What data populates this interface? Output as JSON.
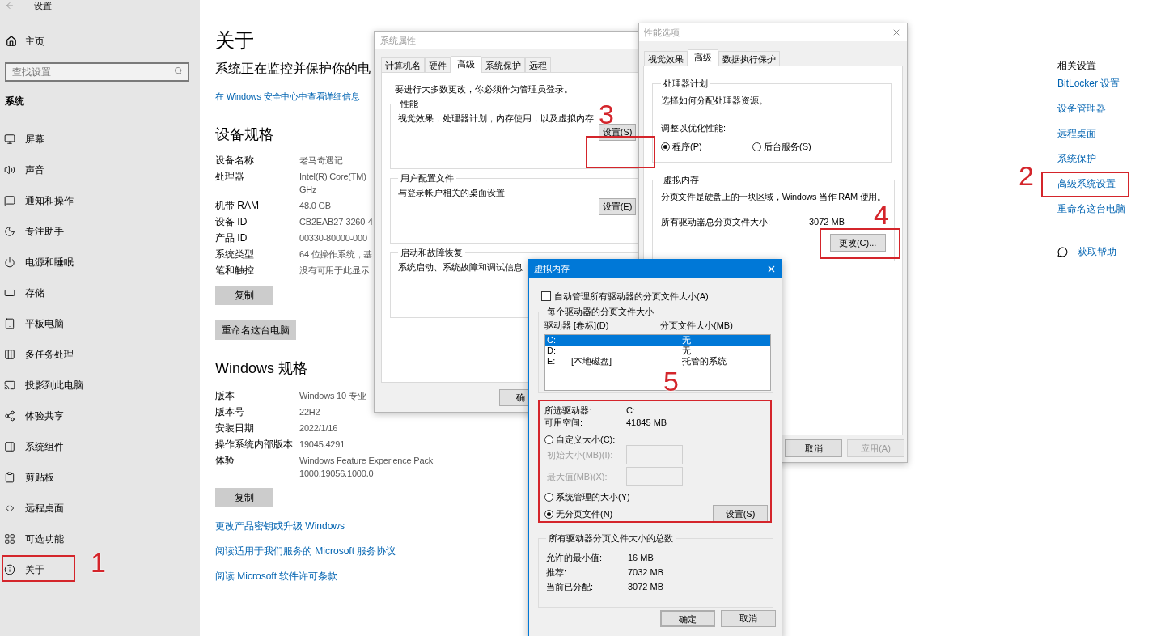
{
  "settings": {
    "title": "设置",
    "home": "主页",
    "search": {
      "placeholder": "查找设置"
    },
    "section": "系统",
    "nav": [
      {
        "label": "屏幕"
      },
      {
        "label": "声音"
      },
      {
        "label": "通知和操作"
      },
      {
        "label": "专注助手"
      },
      {
        "label": "电源和睡眠"
      },
      {
        "label": "存储"
      },
      {
        "label": "平板电脑"
      },
      {
        "label": "多任务处理"
      },
      {
        "label": "投影到此电脑"
      },
      {
        "label": "体验共享"
      },
      {
        "label": "系统组件"
      },
      {
        "label": "剪贴板"
      },
      {
        "label": "远程桌面"
      },
      {
        "label": "可选功能"
      },
      {
        "label": "关于"
      }
    ]
  },
  "about": {
    "title": "关于",
    "status": "系统正在监控并保护你的电",
    "security_link": "在 Windows 安全中心中查看详细信息",
    "device_heading": "设备规格",
    "device_specs": [
      {
        "label": "设备名称",
        "value": "老马奇遇记"
      },
      {
        "label": "处理器",
        "value": "Intel(R) Core(TM)\nGHz"
      },
      {
        "label": "机带 RAM",
        "value": "48.0 GB"
      },
      {
        "label": "设备 ID",
        "value": "CB2EAB27-3260-4"
      },
      {
        "label": "产品 ID",
        "value": "00330-80000-000"
      },
      {
        "label": "系统类型",
        "value": "64 位操作系统，基"
      },
      {
        "label": "笔和触控",
        "value": "没有可用于此显示"
      }
    ],
    "copy_button": "复制",
    "rename_button": "重命名这台电脑",
    "windows_heading": "Windows 规格",
    "windows_specs": [
      {
        "label": "版本",
        "value": "Windows 10 专业"
      },
      {
        "label": "版本号",
        "value": "22H2"
      },
      {
        "label": "安装日期",
        "value": "2022/1/16"
      },
      {
        "label": "操作系统内部版本",
        "value": "19045.4291"
      },
      {
        "label": "体验",
        "value": "Windows Feature Experience Pack\n1000.19056.1000.0"
      }
    ],
    "copy_button_2": "复制",
    "links": [
      "更改产品密钥或升级 Windows",
      "阅读适用于我们服务的 Microsoft 服务协议",
      "阅读 Microsoft 软件许可条款"
    ]
  },
  "related": {
    "heading": "相关设置",
    "links": [
      "BitLocker 设置",
      "设备管理器",
      "远程桌面",
      "系统保护",
      "高级系统设置",
      "重命名这台电脑"
    ],
    "help": "获取帮助"
  },
  "system_properties": {
    "title": "系统属性",
    "tabs": [
      {
        "label": "计算机名",
        "selected": false
      },
      {
        "label": "硬件",
        "selected": false
      },
      {
        "label": "高级",
        "selected": true
      },
      {
        "label": "系统保护",
        "selected": false
      },
      {
        "label": "远程",
        "selected": false
      }
    ],
    "note": "要进行大多数更改，你必须作为管理员登录。",
    "groups": [
      {
        "title": "性能",
        "text": "视觉效果，处理器计划，内存使用，以及虚拟内存",
        "button": "设置(S)"
      },
      {
        "title": "用户配置文件",
        "text": "与登录帐户相关的桌面设置",
        "button": "设置(E)"
      },
      {
        "title": "启动和故障恢复",
        "text": "系统启动、系统故障和调试信息"
      }
    ],
    "ok_button": "确"
  },
  "performance_options": {
    "title": "性能选项",
    "tabs": [
      {
        "label": "视觉效果",
        "selected": false
      },
      {
        "label": "高级",
        "selected": true
      },
      {
        "label": "数据执行保护",
        "selected": false
      }
    ],
    "processor_group": {
      "title": "处理器计划",
      "text": "选择如何分配处理器资源。",
      "prompt": "调整以优化性能:",
      "options": [
        {
          "label": "程序(P)",
          "selected": true
        },
        {
          "label": "后台服务(S)",
          "selected": false
        }
      ]
    },
    "vm_group": {
      "title": "虚拟内存",
      "text": "分页文件是硬盘上的一块区域，Windows 当作 RAM 使用。",
      "total_label": "所有驱动器总分页文件大小:",
      "total_value": "3072 MB",
      "change_button": "更改(C)..."
    },
    "buttons": [
      {
        "label": "取消",
        "disabled": false
      },
      {
        "label": "应用(A)",
        "disabled": true
      }
    ]
  },
  "virtual_memory": {
    "title": "虚拟内存",
    "auto_manage": {
      "label": "自动管理所有驱动器的分页文件大小(A)",
      "checked": false
    },
    "per_drive_title": "每个驱动器的分页文件大小",
    "columns": [
      "驱动器 [卷标](D)",
      "分页文件大小(MB)"
    ],
    "drives": [
      {
        "drive": "C:",
        "size": "无",
        "selected": true
      },
      {
        "drive": "D:",
        "size": "无",
        "selected": false
      },
      {
        "drive": "E:",
        "label": "[本地磁盘]",
        "size": "托管的系统",
        "selected": false
      }
    ],
    "selected_drive_label": "所选驱动器:",
    "selected_drive": "C:",
    "free_label": "可用空间:",
    "free_value": "41845 MB",
    "size_options": [
      {
        "label": "自定义大小(C):",
        "selected": false
      },
      {
        "label": "系统管理的大小(Y)",
        "selected": false
      },
      {
        "label": "无分页文件(N)",
        "selected": true
      }
    ],
    "initial_size": {
      "label": "初始大小(MB)(I):",
      "disabled": true
    },
    "max_size": {
      "label": "最大值(MB)(X):",
      "disabled": true
    },
    "set_button": "设置(S)",
    "totals_title": "所有驱动器分页文件大小的总数",
    "totals": [
      {
        "label": "允许的最小值:",
        "value": "16 MB"
      },
      {
        "label": "推荐:",
        "value": "7032 MB"
      },
      {
        "label": "当前已分配:",
        "value": "3072 MB"
      }
    ],
    "buttons": [
      "确定",
      "取消"
    ]
  },
  "annotations": [
    {
      "number": "1"
    },
    {
      "number": "2"
    },
    {
      "number": "3"
    },
    {
      "number": "4"
    },
    {
      "number": "5"
    }
  ]
}
